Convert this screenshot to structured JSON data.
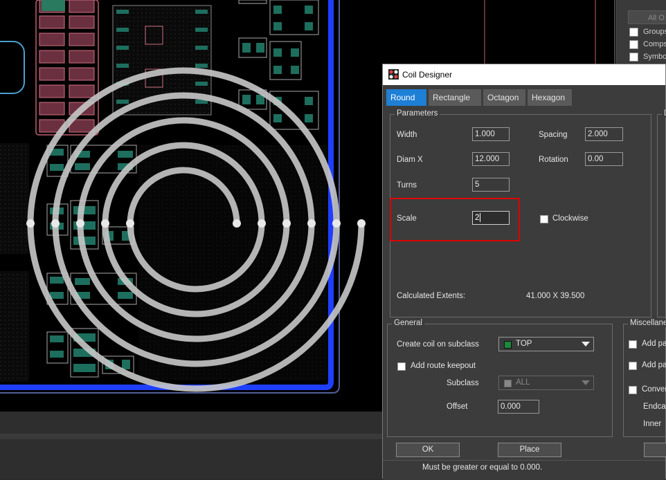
{
  "right_panel": {
    "button_label": "All O",
    "items": [
      {
        "label": "Groups"
      },
      {
        "label": "Comps"
      },
      {
        "label": "Symbo"
      }
    ]
  },
  "dialog": {
    "title": "Coil Designer",
    "tabs": [
      {
        "label": "Round",
        "active": true
      },
      {
        "label": "Rectangle"
      },
      {
        "label": "Octagon"
      },
      {
        "label": "Hexagon"
      }
    ],
    "parameters": {
      "legend": "Parameters",
      "second_legend": "D",
      "width": {
        "label": "Width",
        "value": "1.000"
      },
      "spacing": {
        "label": "Spacing",
        "value": "2.000"
      },
      "diam_x": {
        "label": "Diam X",
        "value": "12.000"
      },
      "rotation": {
        "label": "Rotation",
        "value": "0.00"
      },
      "turns": {
        "label": "Turns",
        "value": "5"
      },
      "scale": {
        "label": "Scale",
        "value": "2"
      },
      "clockwise": {
        "label": "Clockwise",
        "checked": false
      },
      "extents_label": "Calculated Extents:",
      "extents_value": "41.000 X 39.500"
    },
    "general": {
      "legend": "General",
      "create_label": "Create coil on subclass",
      "subclass_value": "TOP",
      "route_keepout_label": "Add route keepout",
      "subclass_label": "Subclass",
      "subclass_disabled_value": "ALL",
      "offset_label": "Offset",
      "offset_value": "0.000"
    },
    "misc": {
      "legend": "Miscellane",
      "items": [
        {
          "label": "Add pa"
        },
        {
          "label": "Add pa"
        },
        {
          "label": "Conver"
        },
        {
          "label": "Endcap"
        },
        {
          "label": "Inner"
        }
      ]
    },
    "buttons": {
      "ok": "OK",
      "place": "Place"
    },
    "status_text": "Must be greater or equal to 0.000."
  },
  "colors": {
    "canvas_bg": "#000000",
    "board_outline": "#1f3fff",
    "coil_preview": "#d0d0d0",
    "pad_pink": "#a85a6a",
    "pad_green": "#1e6e5e",
    "tab_active": "#1e7fd6",
    "highlight": "#e00000"
  }
}
